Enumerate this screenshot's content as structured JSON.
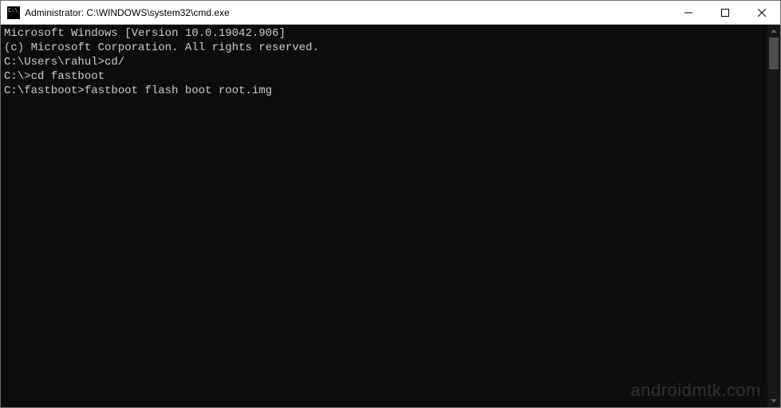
{
  "window": {
    "title": "Administrator: C:\\WINDOWS\\system32\\cmd.exe"
  },
  "terminal": {
    "lines": [
      "Microsoft Windows [Version 10.0.19042.906]",
      "(c) Microsoft Corporation. All rights reserved.",
      "",
      "C:\\Users\\rahul>cd/",
      "",
      "C:\\>cd fastboot",
      "",
      "C:\\fastboot>fastboot flash boot root.img"
    ]
  },
  "watermark": "androidmtk.com"
}
